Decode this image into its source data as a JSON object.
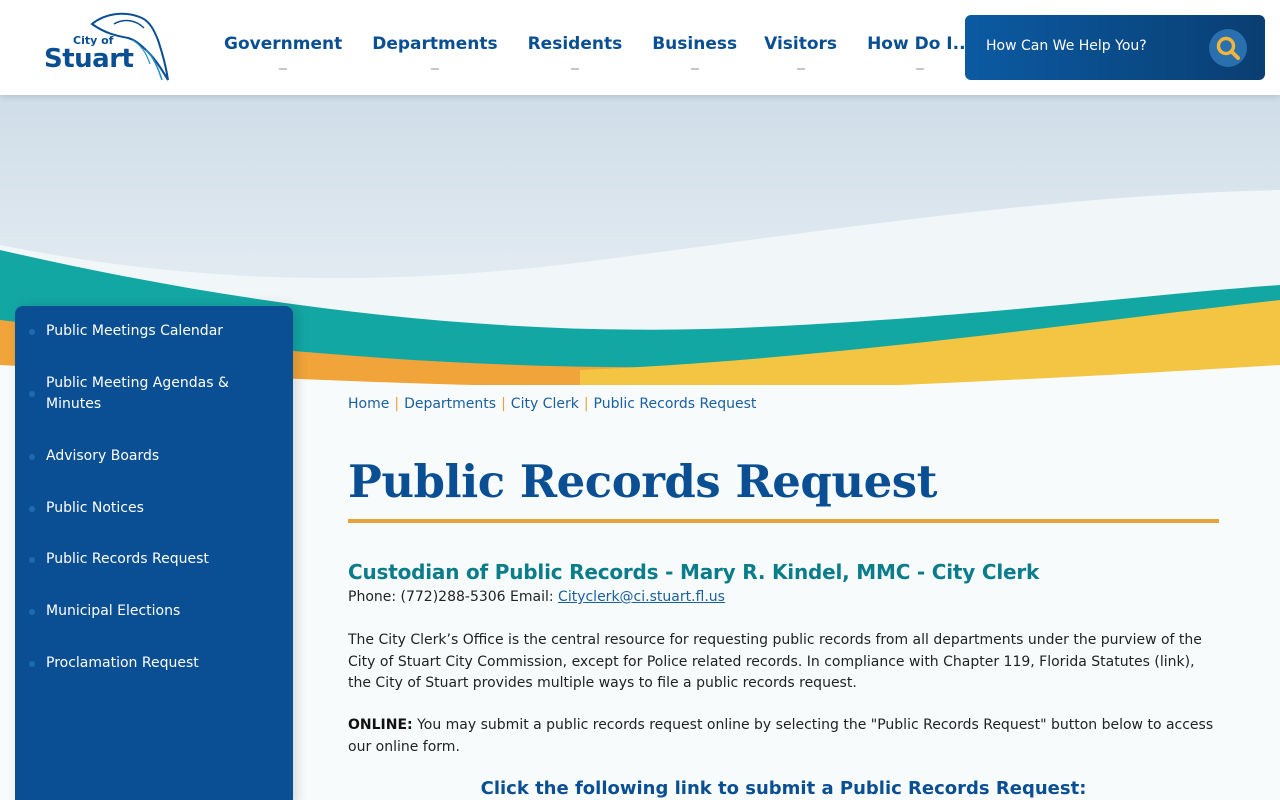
{
  "header": {
    "logo_small": "City of",
    "logo_big": "Stuart",
    "nav": [
      {
        "label": "Government"
      },
      {
        "label": "Departments"
      },
      {
        "label": "Residents"
      },
      {
        "label": "Business"
      },
      {
        "label": "Visitors"
      },
      {
        "label": "How Do I..."
      }
    ],
    "search": {
      "placeholder": "How Can We Help You?",
      "icon": "search-icon"
    }
  },
  "sidebar": {
    "items": [
      {
        "label": "Public Meetings Calendar"
      },
      {
        "label": "Public Meeting Agendas & Minutes"
      },
      {
        "label": "Advisory Boards"
      },
      {
        "label": "Public Notices"
      },
      {
        "label": "Public Records Request"
      },
      {
        "label": "Municipal Elections"
      },
      {
        "label": "Proclamation Request"
      }
    ]
  },
  "breadcrumb": {
    "items": [
      {
        "label": "Home"
      },
      {
        "label": "Departments"
      },
      {
        "label": "City Clerk"
      },
      {
        "label": "Public Records Request"
      }
    ],
    "separator": "|"
  },
  "main": {
    "title": "Public Records Request",
    "custodian": "Custodian of Public Records - Mary R. Kindel, MMC - City Clerk",
    "contact_prefix": "Phone: (772)288-5306 Email: ",
    "contact_email": "Cityclerk@ci.stuart.fl.us",
    "intro": "The City Clerk’s Office is the central resource for requesting public records from all departments under the purview of the City of Stuart City Commission, except for Police related records.  In compliance with Chapter 119, Florida Statutes (link), the City of Stuart provides multiple ways to file a public records request.",
    "online_label": "ONLINE:",
    "online_text": "  You may submit a public records request online by selecting the \"Public Records Request\" button below to access our online form.",
    "cta": "Click the following link to submit a Public Records Request:"
  },
  "colors": {
    "brand_blue": "#0a4f93",
    "teal": "#0b7c8a",
    "accent_orange": "#e9a23b",
    "wave_teal": "#13a7a4",
    "wave_yellow": "#f4c542"
  }
}
